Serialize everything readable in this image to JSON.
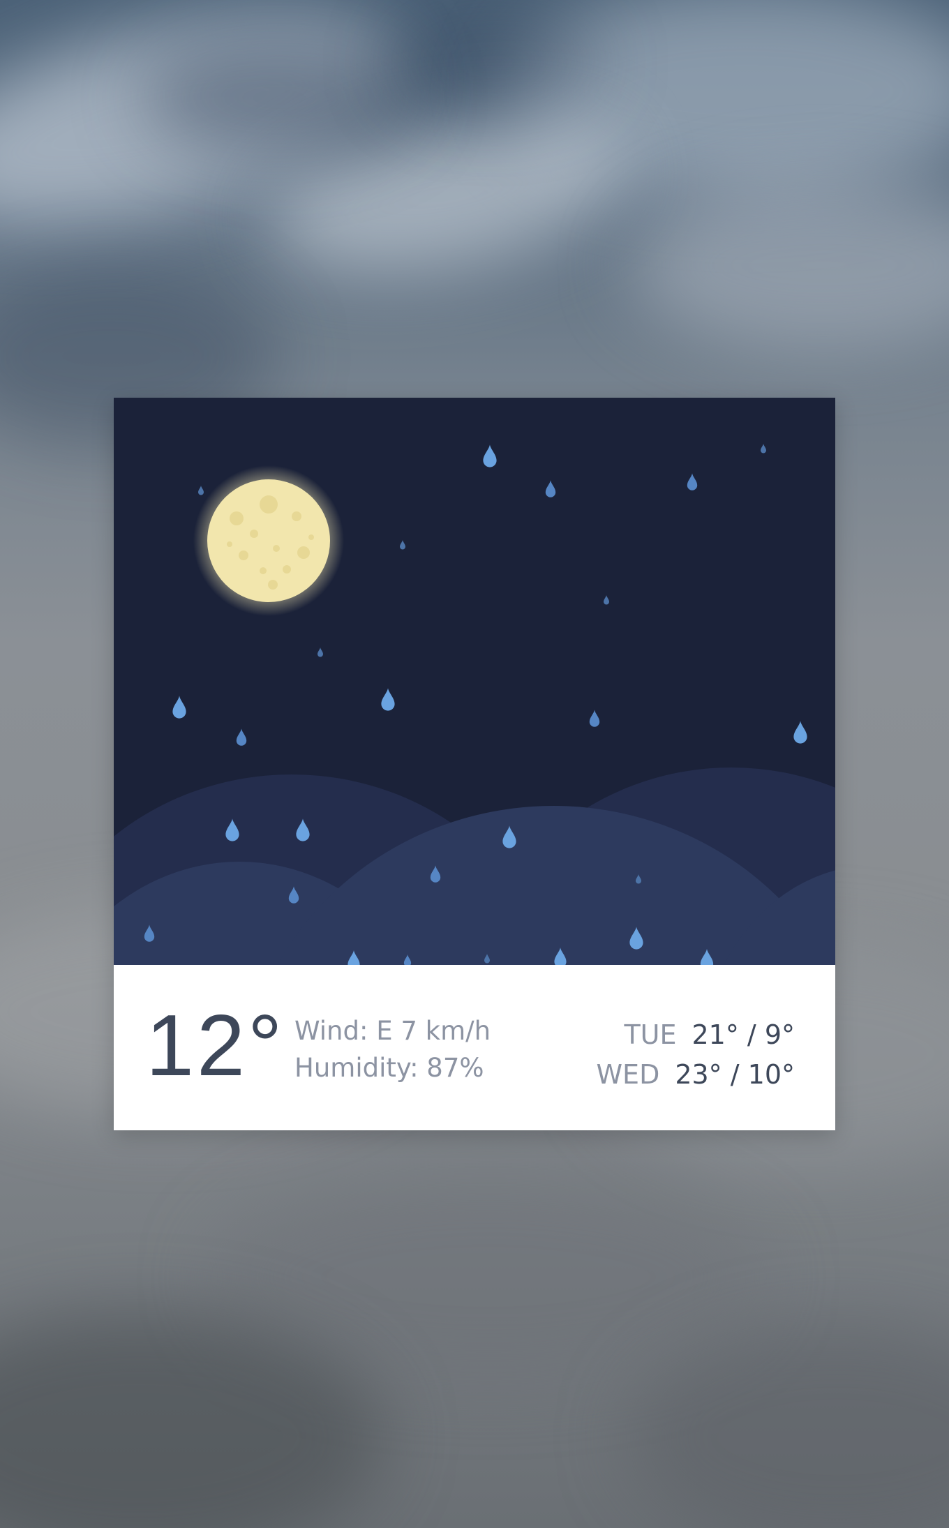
{
  "weather": {
    "temperature": "12°",
    "wind": "Wind: E 7 km/h",
    "humidity": "Humidity: 87%",
    "forecast": [
      {
        "day": "TUE",
        "range": "21° / 9°"
      },
      {
        "day": "WED",
        "range": "23° / 10°"
      }
    ],
    "condition_icon": "moon-icon",
    "precipitation_icon": "raindrop-icon"
  },
  "colors": {
    "night_sky": "#1b2239",
    "hill_back": "#242d4d",
    "hill_front": "#2d3a5e",
    "moon": "#f2e6ad",
    "raindrop": "#6aa3e0",
    "text_dark": "#3d4759",
    "text_muted": "#8c93a2"
  }
}
